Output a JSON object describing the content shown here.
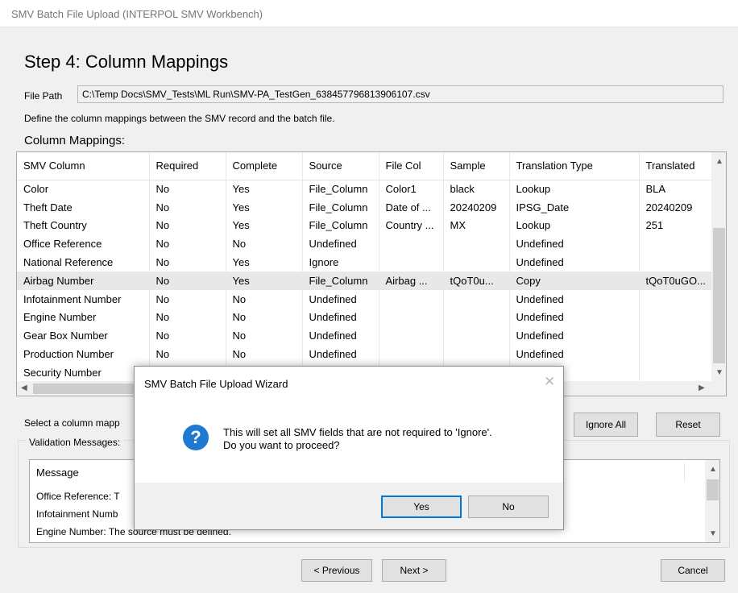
{
  "window": {
    "title": "SMV Batch File Upload (INTERPOL SMV Workbench)"
  },
  "step": {
    "heading": "Step 4: Column Mappings"
  },
  "file_path": {
    "label": "File Path",
    "value": "C:\\Temp Docs\\SMV_Tests\\ML Run\\SMV-PA_TestGen_638457796813906107.csv"
  },
  "description": "Define the column mappings between the SMV record and the batch file.",
  "mappings": {
    "label": "Column Mappings:",
    "columns": [
      "SMV Column",
      "Required",
      "Complete",
      "Source",
      "File Col",
      "Sample",
      "Translation Type",
      "Translated"
    ],
    "rows": [
      [
        "Color",
        "No",
        "Yes",
        "File_Column",
        "Color1",
        "black",
        "Lookup",
        "BLA"
      ],
      [
        "Theft Date",
        "No",
        "Yes",
        "File_Column",
        "Date of ...",
        "20240209",
        "IPSG_Date",
        "20240209"
      ],
      [
        "Theft Country",
        "No",
        "Yes",
        "File_Column",
        "Country ...",
        "MX",
        "Lookup",
        "251"
      ],
      [
        "Office Reference",
        "No",
        "No",
        "Undefined",
        "",
        "",
        "Undefined",
        ""
      ],
      [
        "National Reference",
        "No",
        "Yes",
        "Ignore",
        "",
        "",
        "Undefined",
        ""
      ],
      [
        "Airbag Number",
        "No",
        "Yes",
        "File_Column",
        "Airbag ...",
        "tQoT0u...",
        "Copy",
        "tQoT0uGO..."
      ],
      [
        "Infotainment Number",
        "No",
        "No",
        "Undefined",
        "",
        "",
        "Undefined",
        ""
      ],
      [
        "Engine Number",
        "No",
        "No",
        "Undefined",
        "",
        "",
        "Undefined",
        ""
      ],
      [
        "Gear Box Number",
        "No",
        "No",
        "Undefined",
        "",
        "",
        "Undefined",
        ""
      ],
      [
        "Production Number",
        "No",
        "No",
        "Undefined",
        "",
        "",
        "Undefined",
        ""
      ],
      [
        "Security Number",
        "",
        "",
        "",
        "",
        "",
        "",
        ""
      ]
    ]
  },
  "hint": "Select a column mapp",
  "buttons": {
    "ignore_all": "Ignore All",
    "reset": "Reset",
    "previous": "< Previous",
    "next": "Next >",
    "cancel": "Cancel"
  },
  "validation": {
    "legend": "Validation Messages:",
    "header": "Message",
    "rows": [
      {
        "prefix": "Office Reference: T"
      },
      {
        "prefix": "Infotainment Numb"
      },
      {
        "prefix": "Engine Number: The source must be defined."
      }
    ]
  },
  "dialog": {
    "title": "SMV Batch File Upload Wizard",
    "close": "✕",
    "icon": "question-icon",
    "icon_glyph": "?",
    "line1": "This will set all SMV fields that are not required to 'Ignore'.",
    "line2": "Do you want to proceed?",
    "yes": "Yes",
    "no": "No"
  },
  "colors": {
    "accent": "#0078d7",
    "question_icon": "#1f78d1",
    "selected_row": "#e8e8e8"
  }
}
